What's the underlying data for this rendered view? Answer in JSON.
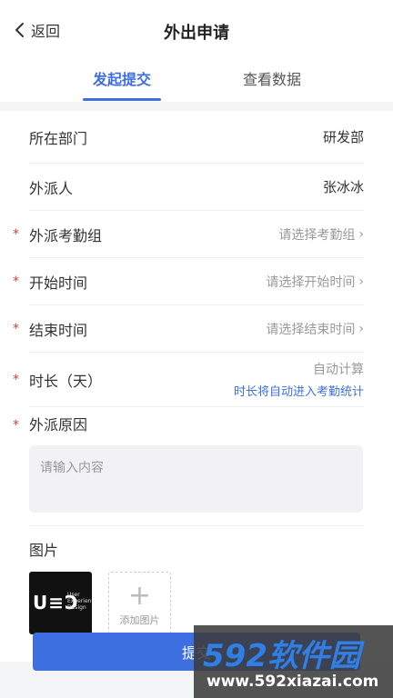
{
  "header": {
    "back_label": "返回",
    "title": "外出申请"
  },
  "tabs": [
    {
      "label": "发起提交",
      "active": true
    },
    {
      "label": "查看数据",
      "active": false
    }
  ],
  "form": {
    "department": {
      "label": "所在部门",
      "value": "研发部"
    },
    "dispatcher": {
      "label": "外派人",
      "value": "张冰冰"
    },
    "attendance_group": {
      "label": "外派考勤组",
      "placeholder": "请选择考勤组",
      "required": true
    },
    "start_time": {
      "label": "开始时间",
      "placeholder": "请选择开始时间",
      "required": true
    },
    "end_time": {
      "label": "结束时间",
      "placeholder": "请选择结束时间",
      "required": true
    },
    "duration": {
      "label": "时长（天）",
      "value": "自动计算",
      "hint": "时长将自动进入考勤统计",
      "required": true
    },
    "reason": {
      "label": "外派原因",
      "placeholder": "请输入内容",
      "required": true
    },
    "images": {
      "label": "图片",
      "add_label": "添加图片",
      "thumb_logo": "U≡Ɔ",
      "thumb_caption": "User Experience Design"
    },
    "required_mark": "*"
  },
  "submit_label": "提交",
  "watermark": {
    "brand": "592软件园",
    "site": "www.592xiazai.com"
  },
  "colors": {
    "accent": "#3e6fe0",
    "required": "#e03b3b",
    "placeholder": "#999999"
  }
}
